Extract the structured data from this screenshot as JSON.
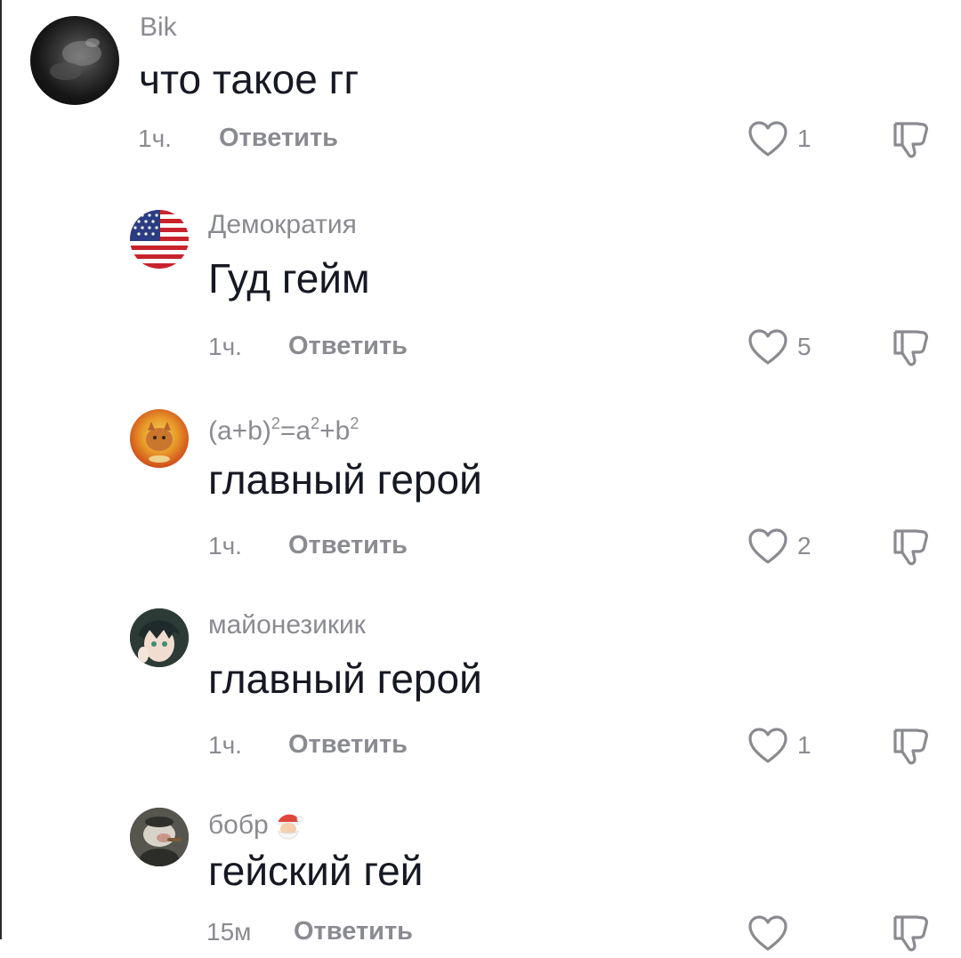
{
  "comments": [
    {
      "username": "Bik",
      "text": "что такое гг",
      "time": "1ч.",
      "reply_label": "Ответить",
      "likes": "1",
      "avatar": "dark-animal-avatar"
    },
    {
      "username": "Демократия",
      "text": "Гуд гейм",
      "time": "1ч.",
      "reply_label": "Ответить",
      "likes": "5",
      "avatar": "usa-flag-avatar"
    },
    {
      "username_parts": [
        "(a+b)",
        "2",
        "=a",
        "2",
        "+b",
        "2"
      ],
      "text": "главный герой",
      "time": "1ч.",
      "reply_label": "Ответить",
      "likes": "2",
      "avatar": "fire-cat-avatar"
    },
    {
      "username": "майонезикик",
      "text": "главный герой",
      "time": "1ч.",
      "reply_label": "Ответить",
      "likes": "1",
      "avatar": "anime-character-avatar"
    },
    {
      "username": "бобр",
      "username_emoji": "santa-emoji",
      "text": "гейский гей",
      "time": "15м",
      "reply_label": "Ответить",
      "likes": "",
      "avatar": "beaver-avatar"
    }
  ],
  "colors": {
    "text": "#161823",
    "muted": "#8a8b91",
    "background": "#ffffff"
  }
}
